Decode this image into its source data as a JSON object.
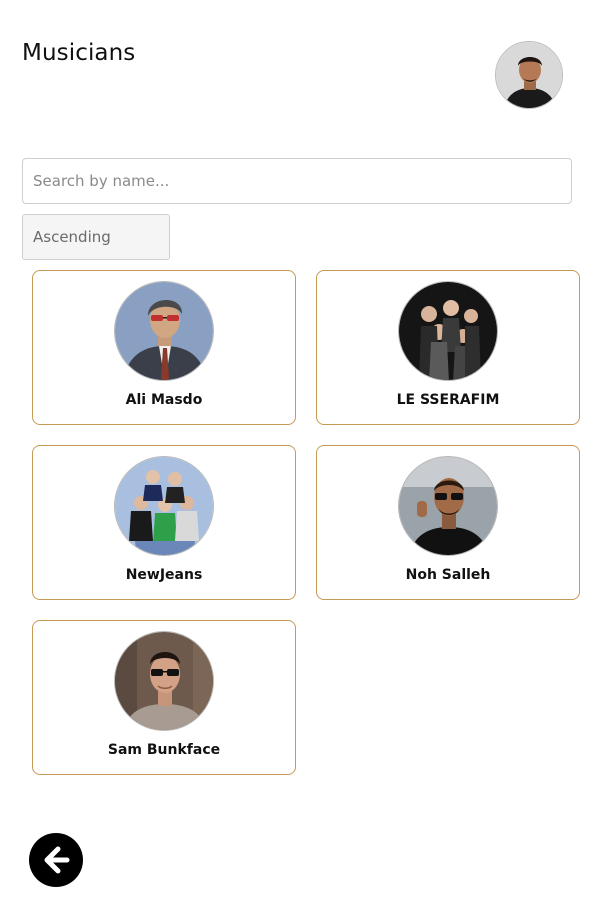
{
  "header": {
    "title": "Musicians",
    "profile_avatar_icon": "user-avatar-icon"
  },
  "search": {
    "placeholder": "Search by name..."
  },
  "sort": {
    "selected": "Ascending"
  },
  "musicians": [
    {
      "name": "Ali Masdo",
      "avatar": "musician-portrait"
    },
    {
      "name": "LE SSERAFIM",
      "avatar": "group-photo"
    },
    {
      "name": "NewJeans",
      "avatar": "group-photo"
    },
    {
      "name": "Noh Salleh",
      "avatar": "musician-portrait"
    },
    {
      "name": "Sam Bunkface",
      "avatar": "musician-portrait"
    }
  ],
  "footer": {
    "back_icon": "arrow-left-icon"
  },
  "colors": {
    "card_border": "#c79a55",
    "back_button": "#000000",
    "select_background": "#f5f5f5"
  }
}
